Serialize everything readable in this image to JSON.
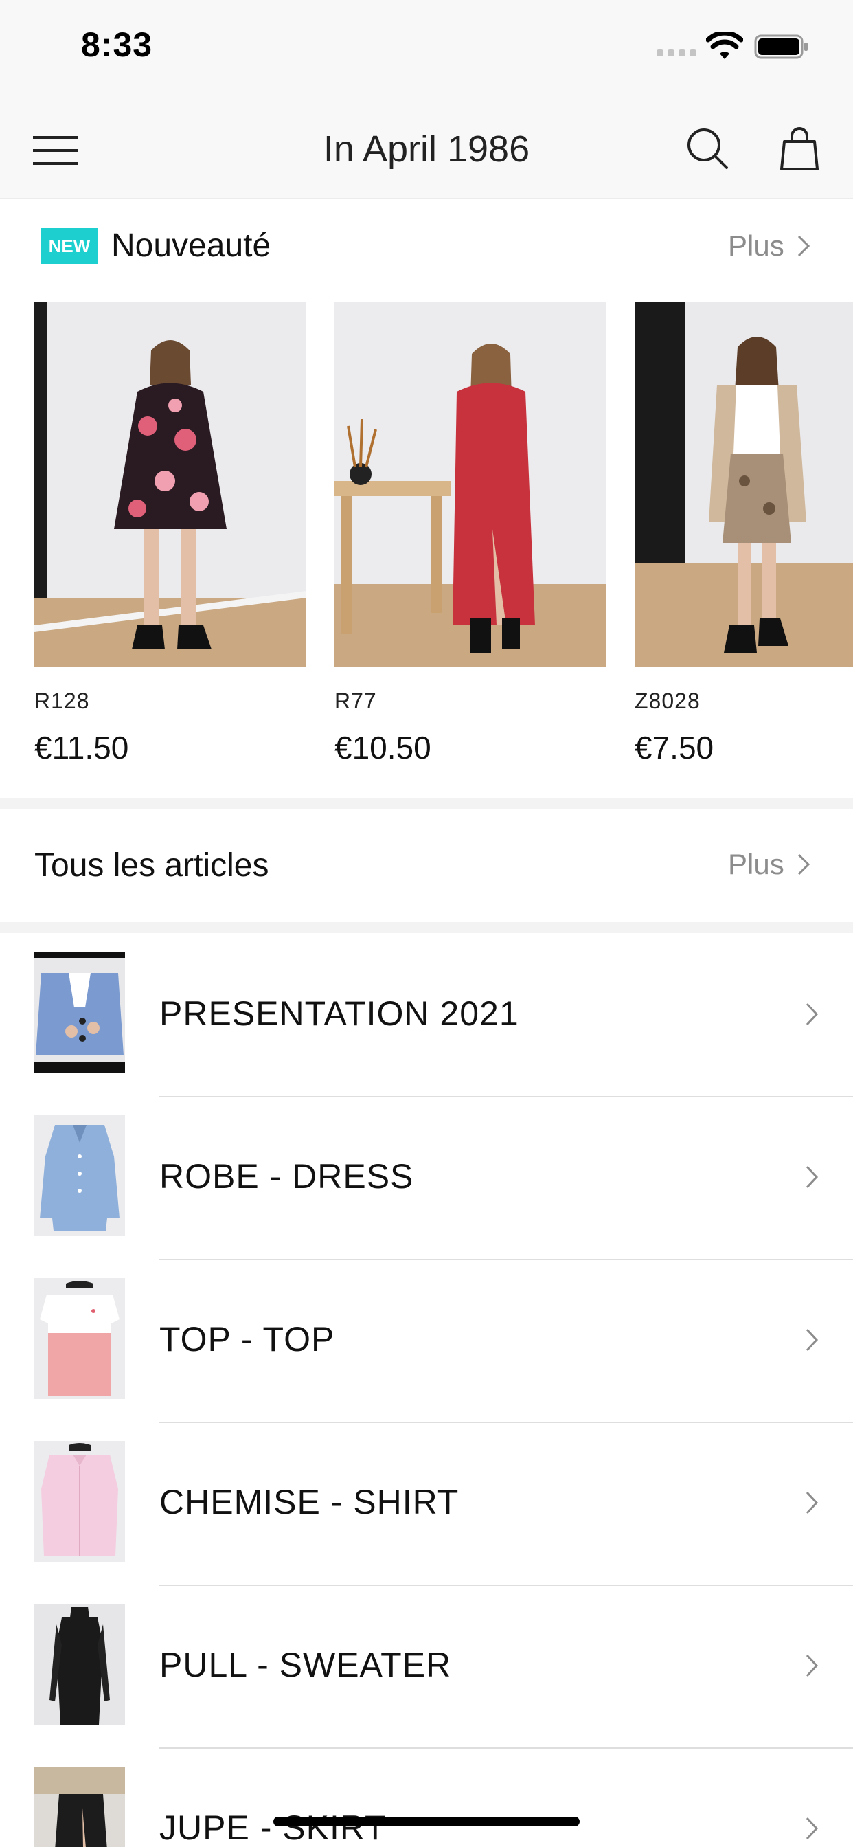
{
  "status": {
    "time": "8:33"
  },
  "nav": {
    "title": "In April 1986"
  },
  "new_section": {
    "badge": "NEW",
    "title": "Nouveauté",
    "more": "Plus",
    "products": [
      {
        "code": "R128",
        "price": "€11.50"
      },
      {
        "code": "R77",
        "price": "€10.50"
      },
      {
        "code": "Z8028",
        "price": "€7.50"
      }
    ]
  },
  "all_section": {
    "title": "Tous les articles",
    "more": "Plus"
  },
  "categories": [
    {
      "label": "PRESENTATION 2021"
    },
    {
      "label": "ROBE - DRESS"
    },
    {
      "label": "TOP - TOP"
    },
    {
      "label": "CHEMISE - SHIRT"
    },
    {
      "label": "PULL - SWEATER"
    },
    {
      "label": "JUPE - SKIRT"
    }
  ],
  "colors": {
    "accent": "#1dcfcf",
    "muted_text": "#8c8c8c",
    "bar_bg": "#f8f8f8"
  }
}
